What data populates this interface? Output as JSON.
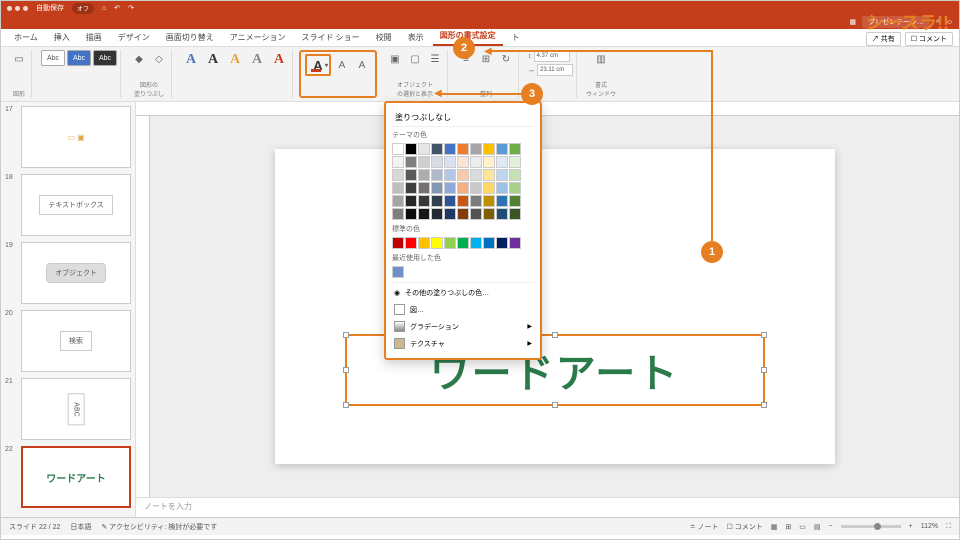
{
  "brand": "シースラ!!",
  "menubar": {
    "autosave_label": "自動保存",
    "autosave_state": "オフ"
  },
  "titlebar": {
    "doc": "プレゼンテーシ…"
  },
  "tabs": {
    "items": [
      "ホーム",
      "挿入",
      "描画",
      "デザイン",
      "画面切り替え",
      "アニメーション",
      "スライド ショー",
      "校閲",
      "表示"
    ],
    "active": "図形の書式設定",
    "truncated": "ト",
    "share": "共有",
    "comment": "コメント"
  },
  "ribbon": {
    "shapes_label": "図形",
    "abc": "Abc",
    "shape_fill_label": "図形の\n塗りつぶし",
    "height": "4.37 cm",
    "width": "23.11 cm",
    "object_label": "オブジェクト\nの選択と表示",
    "align_label": "整列",
    "format_window_label": "書式\nウィンドウ"
  },
  "dropdown": {
    "nofill": "塗りつぶしなし",
    "theme": "テーマの色",
    "standard": "標準の色",
    "recent": "最近使用した色",
    "more": "その他の塗りつぶしの色…",
    "picture": "図…",
    "gradient": "グラデーション",
    "texture": "テクスチャ",
    "theme_colors": [
      "#ffffff",
      "#000000",
      "#e7e6e6",
      "#44546a",
      "#4472c4",
      "#ed7d31",
      "#a5a5a5",
      "#ffc000",
      "#5b9bd5",
      "#70ad47"
    ],
    "theme_shades": [
      [
        "#f2f2f2",
        "#7f7f7f",
        "#d0cece",
        "#d6dce4",
        "#d9e2f3",
        "#fbe4d5",
        "#ededed",
        "#fff2cc",
        "#deeaf6",
        "#e2efd9"
      ],
      [
        "#d8d8d8",
        "#595959",
        "#aeabab",
        "#adb9ca",
        "#b4c6e7",
        "#f7caac",
        "#dbdbdb",
        "#fee599",
        "#bdd6ee",
        "#c5e0b3"
      ],
      [
        "#bfbfbf",
        "#3f3f3f",
        "#757070",
        "#8496b0",
        "#8eaadb",
        "#f4b083",
        "#c9c9c9",
        "#ffd965",
        "#9cc2e5",
        "#a8d08d"
      ],
      [
        "#a5a5a5",
        "#262626",
        "#3a3838",
        "#323f4f",
        "#2f5496",
        "#c45911",
        "#7b7b7b",
        "#bf8f00",
        "#2e74b5",
        "#538135"
      ],
      [
        "#7f7f7f",
        "#0c0c0c",
        "#171616",
        "#222a35",
        "#1f3864",
        "#833c0b",
        "#525252",
        "#7f6000",
        "#1f4e79",
        "#375623"
      ]
    ],
    "standard_colors": [
      "#c00000",
      "#ff0000",
      "#ffc000",
      "#ffff00",
      "#92d050",
      "#00b050",
      "#00b0f0",
      "#0070c0",
      "#002060",
      "#7030a0"
    ],
    "recent_colors": [
      "#6f8fc9"
    ]
  },
  "thumbs": [
    {
      "n": "17",
      "kind": "icons"
    },
    {
      "n": "18",
      "label": "テキストボックス",
      "kind": "box"
    },
    {
      "n": "19",
      "label": "オブジェクト",
      "kind": "graybox"
    },
    {
      "n": "20",
      "label": "検索",
      "kind": "box"
    },
    {
      "n": "21",
      "label": "ABC",
      "kind": "vtext"
    },
    {
      "n": "22",
      "label": "ワードアート",
      "kind": "wordart",
      "selected": true
    }
  ],
  "canvas": {
    "wordart": "ワードアート"
  },
  "notes_placeholder": "ノートを入力",
  "status": {
    "slide": "スライド 22 / 22",
    "lang": "日本語",
    "a11y": "アクセシビリティ: 検討が必要です",
    "notes": "ノート",
    "comments": "コメント",
    "zoom": "112%"
  },
  "annotations": {
    "b1": "1",
    "b2": "2",
    "b3": "3"
  }
}
